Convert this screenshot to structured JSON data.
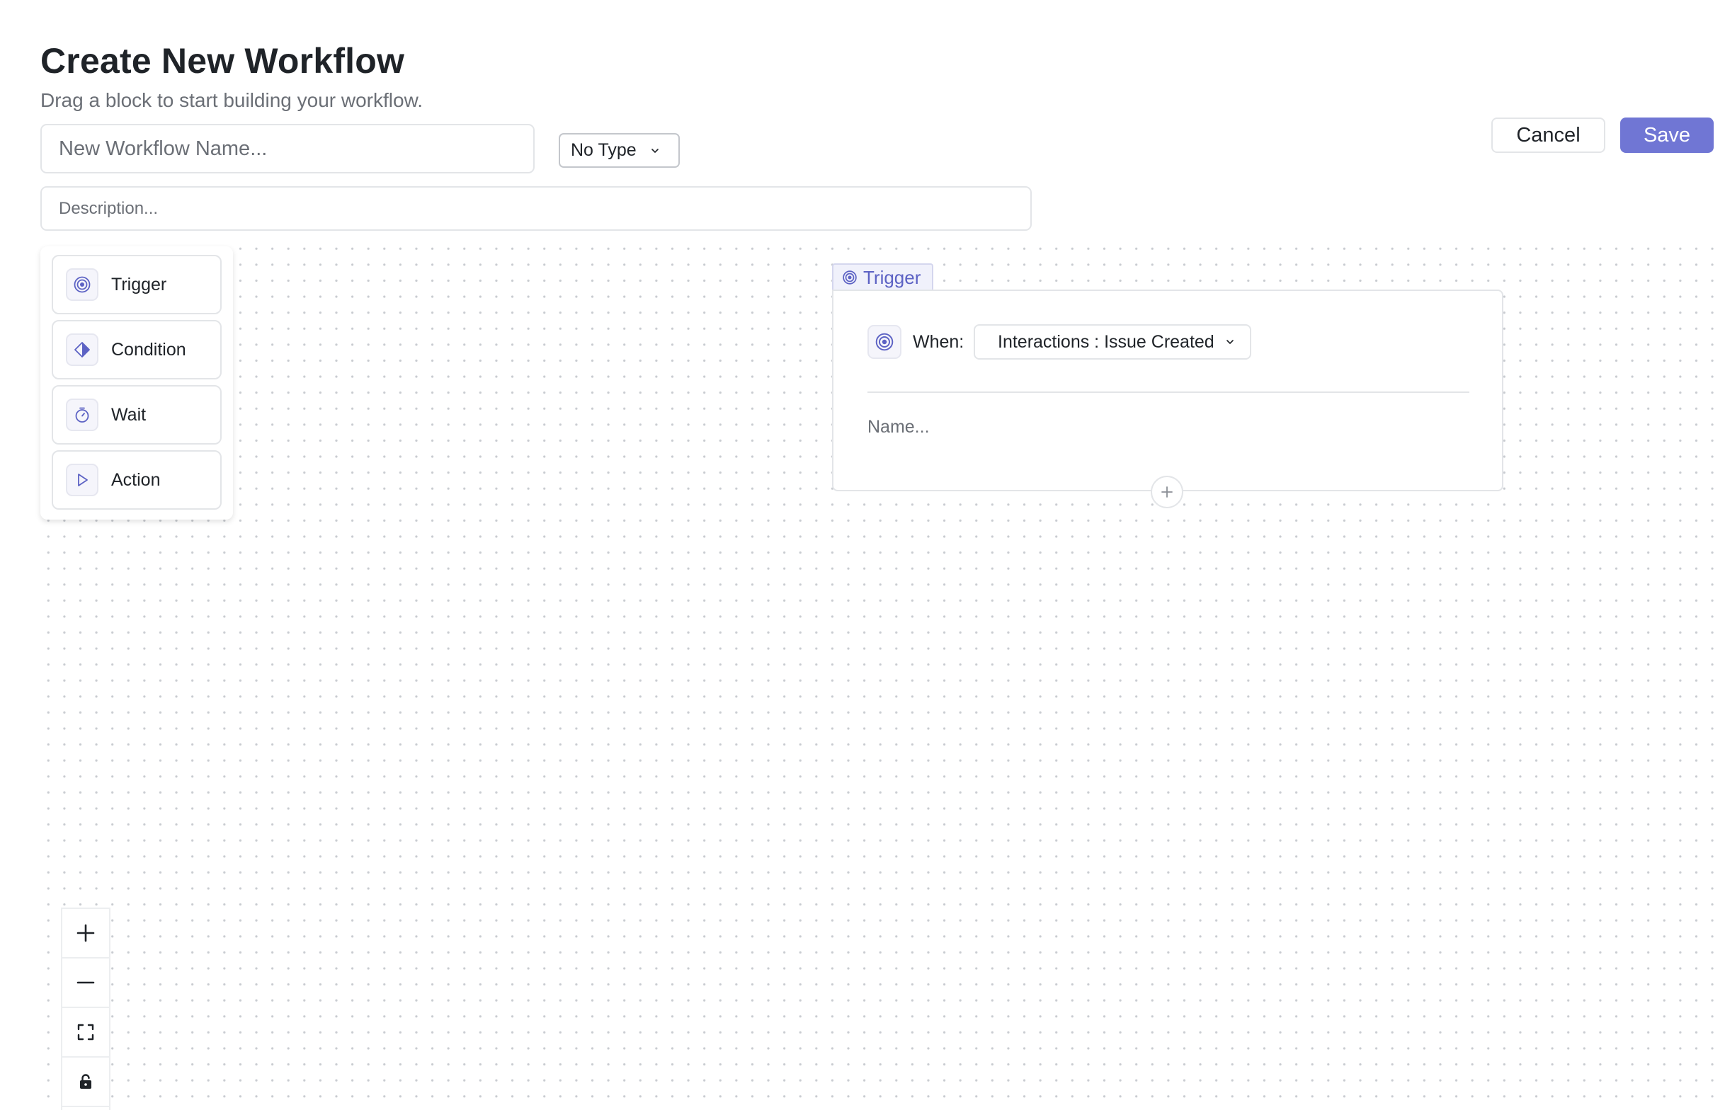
{
  "header": {
    "title": "Create New Workflow",
    "subtitle": "Drag a block to start building your workflow."
  },
  "form": {
    "name_placeholder": "New Workflow Name...",
    "name_value": "",
    "type_selected": "No Type",
    "description_placeholder": "Description...",
    "description_value": ""
  },
  "actions": {
    "cancel_label": "Cancel",
    "save_label": "Save"
  },
  "palette": {
    "items": [
      {
        "label": "Trigger",
        "icon": "target-icon"
      },
      {
        "label": "Condition",
        "icon": "diamond-icon"
      },
      {
        "label": "Wait",
        "icon": "stopwatch-icon"
      },
      {
        "label": "Action",
        "icon": "play-icon"
      }
    ]
  },
  "node": {
    "tab_label": "Trigger",
    "when_label": "When:",
    "event_selected": "Interactions : Issue Created",
    "name_placeholder": "Name...",
    "name_value": ""
  },
  "zoom_controls": [
    "plus-icon",
    "minus-icon",
    "fit-view-icon",
    "lock-icon"
  ],
  "colors": {
    "accent": "#7076d4",
    "accent_text": "#5c62c4",
    "border": "#e3e5e8",
    "muted_text": "#6b6f76"
  }
}
